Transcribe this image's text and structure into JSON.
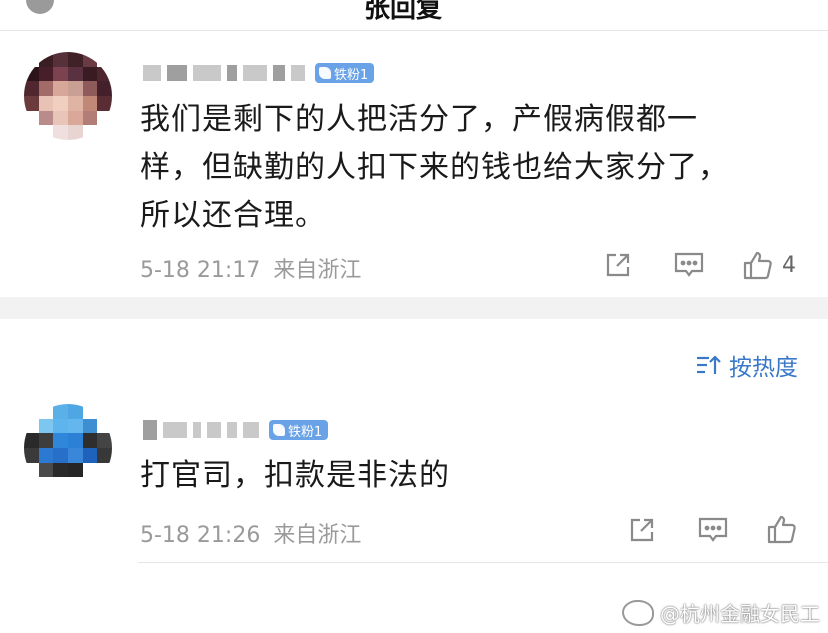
{
  "header": {
    "title": "张回复"
  },
  "comments": [
    {
      "badge": "铁粉1",
      "text_lines": [
        "我们是剩下的人把活分了，产假病假都一",
        "样，但缺勤的人扣下来的钱也给大家分了，",
        "所以还合理。"
      ],
      "time": "5-18 21:17",
      "location": "来自浙江",
      "likes": "4"
    },
    {
      "badge": "铁粉1",
      "text_lines": [
        "打官司，扣款是非法的"
      ],
      "time": "5-18 21:26",
      "location": "来自浙江",
      "likes": ""
    }
  ],
  "sort": {
    "label": "按热度"
  },
  "watermark": {
    "text": "@杭州金融女民工"
  },
  "icons": {
    "share": "share-icon",
    "reply": "comment-icon",
    "like": "thumbs-up-icon",
    "sort": "sort-icon"
  }
}
